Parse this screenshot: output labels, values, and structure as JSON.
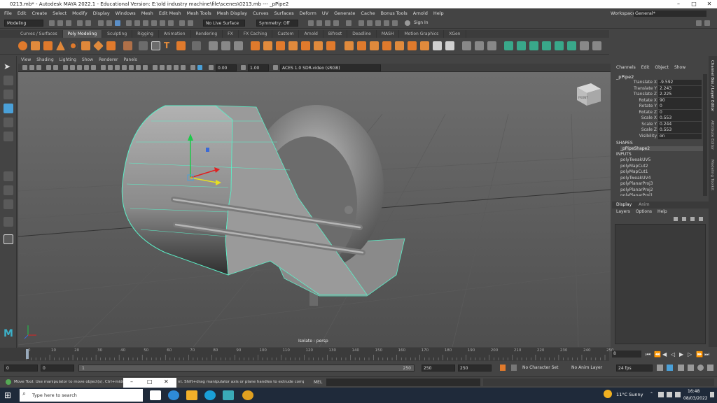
{
  "titlebar": {
    "title": "0213.mb* - Autodesk MAYA 2022.1 - Educational Version: E:\\old industry machine\\file\\scenes\\0213.mb  ---  _pPipe2",
    "min": "–",
    "max": "□",
    "close": "✕"
  },
  "menu": [
    "File",
    "Edit",
    "Create",
    "Select",
    "Modify",
    "Display",
    "Windows",
    "Mesh",
    "Edit Mesh",
    "Mesh Tools",
    "Mesh Display",
    "Curves",
    "Surfaces",
    "Deform",
    "UV",
    "Generate",
    "Cache",
    "Bonus Tools",
    "Arnold",
    "Help"
  ],
  "workspace": {
    "label": "Workspace:",
    "value": "General*"
  },
  "status": {
    "mode": "Modeling",
    "live": "No Live Surface",
    "symmetry": "Symmetry: Off",
    "signin": "Sign In"
  },
  "shelf_tabs": [
    "Curves / Surfaces",
    "Poly Modeling",
    "Sculpting",
    "Rigging",
    "Animation",
    "Rendering",
    "FX",
    "FX Caching",
    "Custom",
    "Arnold",
    "Bifrost",
    "Deadline",
    "MASH",
    "Motion Graphics",
    "XGen"
  ],
  "panel_menu": [
    "View",
    "Shading",
    "Lighting",
    "Show",
    "Renderer",
    "Panels"
  ],
  "panel_tools": {
    "val1": "0.00",
    "val2": "1.00",
    "colorspace": "ACES 1.0 SDR-video (sRGB)"
  },
  "viewport": {
    "label": "Isolate : persp",
    "cube_label": "FRONT"
  },
  "channelbox": {
    "tabs": [
      "Channels",
      "Edit",
      "Object",
      "Show"
    ],
    "object": "_pPipe2",
    "attrs": [
      {
        "name": "Translate X",
        "value": "-9.592"
      },
      {
        "name": "Translate Y",
        "value": "2.243"
      },
      {
        "name": "Translate Z",
        "value": "2.225"
      },
      {
        "name": "Rotate X",
        "value": "90"
      },
      {
        "name": "Rotate Y",
        "value": "0"
      },
      {
        "name": "Rotate Z",
        "value": "0"
      },
      {
        "name": "Scale X",
        "value": "0.553"
      },
      {
        "name": "Scale Y",
        "value": "0.244"
      },
      {
        "name": "Scale Z",
        "value": "0.553"
      },
      {
        "name": "Visibility",
        "value": "on"
      }
    ],
    "shapes_header": "SHAPES",
    "shape": "_pPipeShape2",
    "inputs_header": "INPUTS",
    "inputs": [
      "polyTweakUV5",
      "polyMapCut2",
      "polyMapCut1",
      "polyTweakUV4",
      "polyPlanarProj3",
      "polyPlanarProj2",
      "polyPlanarProj1"
    ]
  },
  "layer_editor": {
    "tabs": [
      "Display",
      "Anim"
    ],
    "menu": [
      "Layers",
      "Options",
      "Help"
    ]
  },
  "side_tabs": [
    "Channel Box / Layer Editor",
    "Attribute Editor",
    "Modeling Toolkit"
  ],
  "timeline": {
    "ticks": [
      "0",
      "10",
      "20",
      "30",
      "40",
      "50",
      "60",
      "70",
      "80",
      "90",
      "100",
      "110",
      "120",
      "130",
      "140",
      "150",
      "160",
      "170",
      "180",
      "190",
      "200",
      "210",
      "220",
      "230",
      "240",
      "250"
    ],
    "current": "0"
  },
  "range": {
    "start": "0",
    "anim_start": "0",
    "playback_start": "1",
    "playback_end": "250",
    "anim_end": "250",
    "end": "250",
    "current_frame": "8",
    "character": "No Character Set",
    "anim_layer": "No Anim Layer",
    "fps": "24 fps"
  },
  "helpline": {
    "text": "Move Tool: Use manipulator to move object(s). Ctrl+middle-drag",
    "text2": "nt. Shift+drag manipulator axis or plane handles to extrude components or c",
    "mel": "MEL"
  },
  "taskbar": {
    "search": "Type here to search",
    "weather": "11°C  Sunny",
    "time": "16:48",
    "date": "08/03/2022"
  },
  "colors": {
    "accent": "#4aa0d8",
    "wire": "#5cf0c8"
  }
}
